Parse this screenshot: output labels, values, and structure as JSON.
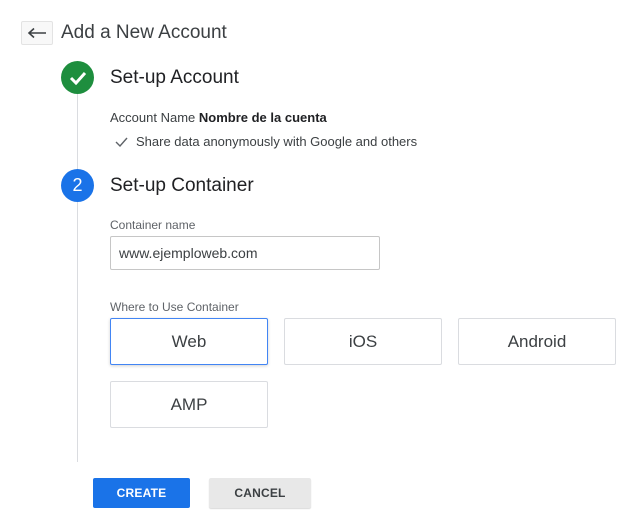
{
  "header": {
    "title": "Add a New Account",
    "back_icon": "back-arrow-icon"
  },
  "step1": {
    "title": "Set-up Account",
    "account_name_label": "Account Name",
    "account_name_value": "Nombre de la cuenta",
    "share_text": "Share data anonymously with Google and others",
    "status_color": "#1e8e3e"
  },
  "step2": {
    "number": "2",
    "title": "Set-up Container",
    "container_name_label": "Container name",
    "container_name_value": "www.ejemploweb.com",
    "where_label": "Where to Use Container",
    "status_color": "#1a73e8",
    "platforms": [
      {
        "label": "Web",
        "selected": true
      },
      {
        "label": "iOS",
        "selected": false
      },
      {
        "label": "Android",
        "selected": false
      },
      {
        "label": "AMP",
        "selected": false
      }
    ]
  },
  "actions": {
    "create_label": "CREATE",
    "cancel_label": "CANCEL",
    "accent": "#1a73e8"
  }
}
